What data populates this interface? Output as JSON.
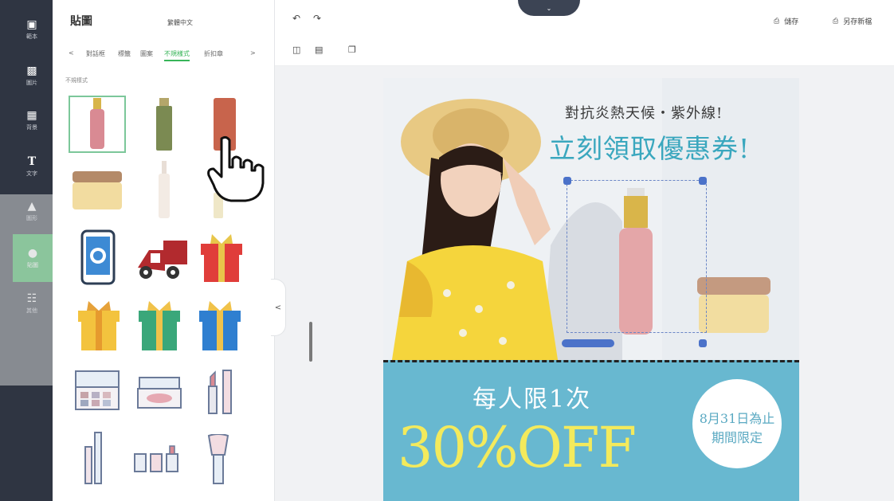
{
  "sidebar": {
    "items": [
      {
        "label": "範本",
        "icon": "template-icon"
      },
      {
        "label": "圖片",
        "icon": "image-icon"
      },
      {
        "label": "背景",
        "icon": "background-icon"
      },
      {
        "label": "文字",
        "icon": "text-icon"
      },
      {
        "label": "圖形",
        "icon": "shape-icon"
      },
      {
        "label": "貼圖",
        "icon": "sticker-icon",
        "active": true
      },
      {
        "label": "其他",
        "icon": "other-icon"
      }
    ]
  },
  "panel": {
    "title": "貼圖",
    "language": "繁體中文",
    "categories": [
      "對話框",
      "標籤",
      "圖案",
      "不規樣式",
      "折扣章"
    ],
    "active_category": "不規樣式",
    "section_label": "不規樣式"
  },
  "toolbar": {
    "save_label": "儲存",
    "save_as_label": "另存新檔"
  },
  "poster": {
    "headline_small": "對抗炎熱天候・紫外線!",
    "headline_large": "立刻領取優惠券!",
    "banner_line1": "每人限1次",
    "banner_line2": "30%OFF",
    "badge_line1": "8月31日為止",
    "badge_line2": "期間限定"
  },
  "colors": {
    "accent_green": "#38b559",
    "rail_dark": "#2f3542",
    "poster_blue": "#68b8d0",
    "poster_yellow": "#f3ea5c",
    "headline_blue": "#3aa7be",
    "selection_blue": "#4b72c9"
  }
}
